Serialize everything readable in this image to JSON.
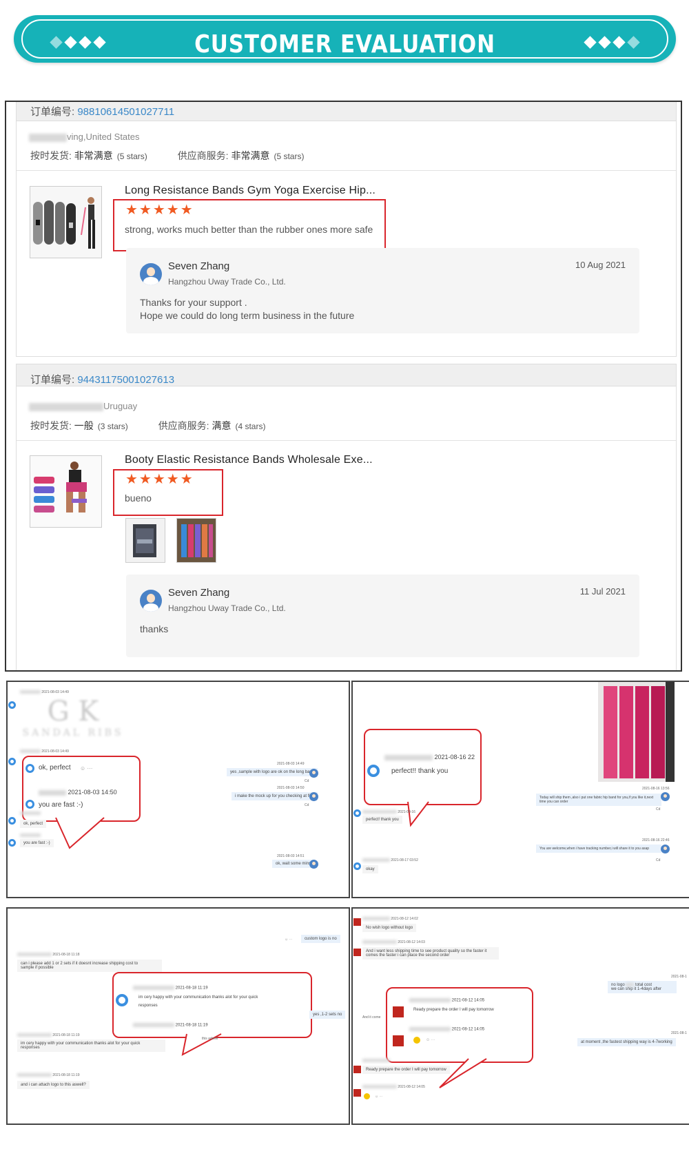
{
  "banner": {
    "title": "CUSTOMER EVALUATION"
  },
  "orders": [
    {
      "order_label": "订单编号:",
      "order_number": "98810614501027711",
      "buyer_location": "ving,United States",
      "delivery_label": "按时发货:",
      "delivery_rating": "非常满意",
      "delivery_stars": "(5 stars)",
      "service_label": "供应商服务:",
      "service_rating": "非常满意",
      "service_stars": "(5 stars)",
      "product_title": "Long Resistance Bands Gym Yoga Exercise Hip...",
      "stars": "★★★★★",
      "review": "strong, works much better than the rubber ones more safe",
      "reply": {
        "name": "Seven Zhang",
        "company": "Hangzhou Uway Trade Co., Ltd.",
        "date": "10 Aug 2021",
        "line1": "Thanks for your support .",
        "line2": "Hope we could do long term business in the future"
      }
    },
    {
      "order_label": "订单编号:",
      "order_number": "94431175001027613",
      "buyer_location": "Uruguay",
      "delivery_label": "按时发货:",
      "delivery_rating": "一般",
      "delivery_stars": "(3 stars)",
      "service_label": "供应商服务:",
      "service_rating": "满意",
      "service_stars": "(4 stars)",
      "product_title": "Booty Elastic Resistance Bands Wholesale Exe...",
      "stars": "★★★★★",
      "review": "bueno",
      "reply": {
        "name": "Seven Zhang",
        "company": "Hangzhou Uway Trade Co., Ltd.",
        "date": "11 Jul 2021",
        "line1": "thanks"
      }
    }
  ],
  "chats": {
    "c1": {
      "ts1": "2021-08-03 14:49",
      "ts2": "2021-08-03 14:49",
      "callout_msg1": "ok, perfect",
      "callout_ts": "2021-08-03 14:50",
      "callout_msg2": "you are fast :-)",
      "right_msg1": "yes ,sample with logo are ok on the long band",
      "right_msg2": "i make the mock up for you checking at first",
      "right_ts1": "2021-08-03 14:49",
      "right_ts2": "2021-08-03 14:50",
      "small_msg1": "ok, perfect",
      "small_msg2": "you are fast :-)",
      "right_msg3": "ok, wait some mins",
      "right_ts3": "2021-08-03 14:51",
      "read": "Cd",
      "dots": "☺ ···"
    },
    "c2": {
      "callout_ts": "2021-08-16 22",
      "callout_msg": "perfect!! thank you",
      "small_msg": "perfect! thank you",
      "right_msg1": "Today will ship them ,also i put one fabric hip band for you,if you like it,next time you can order",
      "right_msg2": "You are welcome,when i have tracking number,i will share it to you asap",
      "right_ts1": "2021-08-16 13:56",
      "right_ts2": "2021-08-16 22:46",
      "okay": "okay",
      "ts_bottom": "2021-08-17 03:52"
    },
    "c3": {
      "top_right": "custom logo is no",
      "ts1": "2021-08-18 11:18",
      "msg1_line1": "can i please add 1 or 2 sets if it doesnt increase shipping cost to",
      "msg1_line2": "sample if possible",
      "callout_ts1": "2021-08-18 11:19",
      "callout_msg_line1": "im cery happy with your communication thanks alot for your quick",
      "callout_msg_line2": "responses",
      "callout_ts2": "2021-08-18 11:19",
      "right_snip1": "yes ,1-2 sets no",
      "right_snip2": "this adwell",
      "ts2": "2021-08-18 11:19",
      "msg2_line1": "im cery happy with your communication thanks alot for your quick",
      "msg2_line2": "responses",
      "ts3": "2021-08-18 11:19",
      "msg3": "and i can attach logo to this aswell?"
    },
    "c4": {
      "ts1": "2021-08-12 14:02",
      "msg1": "No wish logo without logo",
      "ts2": "2021-08-12 14:03",
      "msg2_line1": "And i want less shipping time to see product quality so the faster it",
      "msg2_line2": "comes the faster i can place the second order",
      "right_msg1": "no logo",
      "right_msg1b": "total cost",
      "right_msg2": "we can ship it 1-4days after",
      "callout_ts1": "2021-08-12 14:05",
      "callout_msg": "Ready prepare the order I will pay tomorrow",
      "callout_ts2": "2021-08-12 14:05",
      "left_snip": "And it come",
      "right_msg3": "at moment ,the fastest shipping way is 4-7working",
      "small_msg": "Ready prepare the order I will pay tomorrow",
      "ts_bottom": "2021-08-12 14:05",
      "right_ts": "2021-08-1"
    }
  }
}
